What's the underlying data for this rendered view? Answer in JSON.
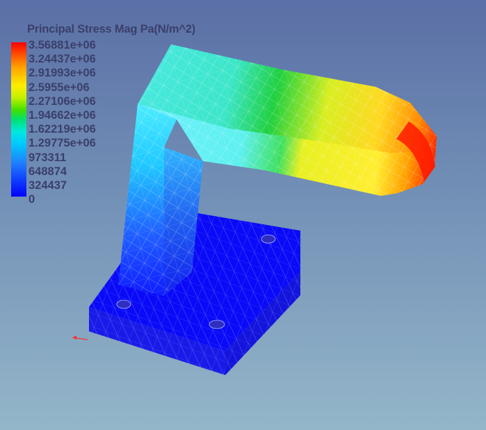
{
  "legend": {
    "title": "Principal Stress Mag Pa(N/m^2)",
    "labels": [
      "3.56881e+06",
      "3.24437e+06",
      "2.91993e+06",
      "2.5955e+06",
      "2.27106e+06",
      "1.94662e+06",
      "1.62219e+06",
      "1.29775e+06",
      "973311",
      "648874",
      "324437",
      "0"
    ],
    "colors": [
      "#ff0000",
      "#ff5000",
      "#ffa000",
      "#ffee00",
      "#c0f000",
      "#40e000",
      "#00e070",
      "#00e8e0",
      "#00c8ff",
      "#2080ff",
      "#0000ff"
    ]
  },
  "model": {
    "colors": {
      "base": "#1010f0",
      "red": "#ff1a00",
      "yellow": "#ffee20",
      "green": "#30d060",
      "cyan": "#30e8e0",
      "mesh_line": "#ffffff"
    }
  }
}
